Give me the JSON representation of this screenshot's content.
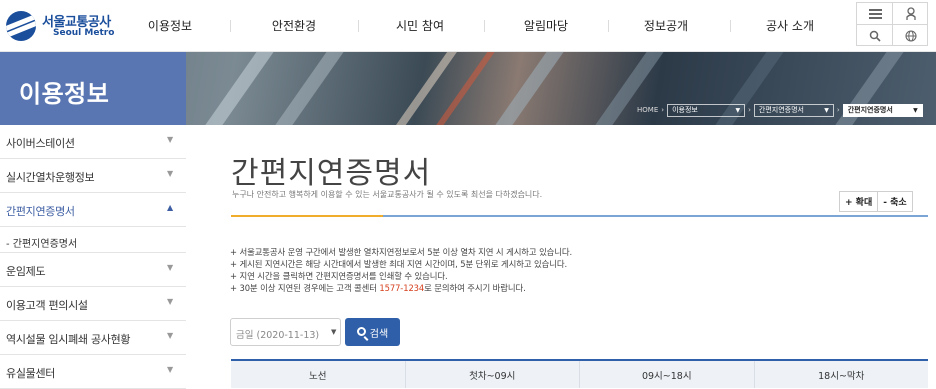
{
  "logo": {
    "ko": "서울교통공사",
    "en": "Seoul Metro"
  },
  "nav": [
    "이용정보",
    "안전환경",
    "시민 참여",
    "알림마당",
    "정보공개",
    "공사 소개"
  ],
  "util": [
    "menu-icon",
    "user-icon",
    "search-icon",
    "globe-icon"
  ],
  "banner": {
    "title": "이용정보",
    "breadcrumb": {
      "home": "HOME",
      "level1": "이용정보",
      "level2": "간편지연증명서",
      "level3": "간편지연증명서"
    }
  },
  "sidebar": {
    "items": [
      {
        "label": "사이버스테이션",
        "chev": "▼"
      },
      {
        "label": "실시간열차운행정보",
        "chev": "▼"
      },
      {
        "label": "간편지연증명서",
        "chev": "▲"
      },
      {
        "label": "운임제도",
        "chev": "▼"
      },
      {
        "label": "이용고객 편의시설",
        "chev": "▼"
      },
      {
        "label": "역시설물 임시폐쇄 공사현황",
        "chev": "▼"
      },
      {
        "label": "유실물센터",
        "chev": "▼"
      }
    ],
    "sub_item": "- 간편지연증명서"
  },
  "main": {
    "title": "간편지연증명서",
    "subtitle": "누구나 안전하고 행복하게 이용할 수 있는 서울교통공사가 될 수 있도록 최선을 다하겠습니다.",
    "zoom_in": "+ 확대",
    "zoom_out": "- 축소",
    "notices": [
      "+ 서울교통공사 운영 구간에서 발생한 열차지연정보로서 5분 이상 열차 지연 시 게시하고 있습니다.",
      "+ 게시된 지연시간은 해당 시간대에서 발생한 최대 지연 시간이며, 5분 단위로 게시하고 있습니다.",
      "+ 지연 시간을 클릭하면 간편지연증명서를 인쇄할 수 있습니다."
    ],
    "notice_last": {
      "before": "+ 30분 이상 지연된 경우에는 고객 콜센터 ",
      "tel": "1577-1234",
      "after": "로 문의하여 주시기 바랍니다."
    },
    "date_select": "금일 (2020-11-13)",
    "search_label": "검색",
    "table_headers": [
      "노선",
      "첫차~09시",
      "09시~18시",
      "18시~막차"
    ]
  },
  "colors": {
    "brand": "#1b4f9c",
    "side_panel": "#5a76b2",
    "accent_orange": "#f0ad2c",
    "accent_blue": "#7aa6d6",
    "button": "#2f5fa8",
    "tel": "#d6401f"
  }
}
